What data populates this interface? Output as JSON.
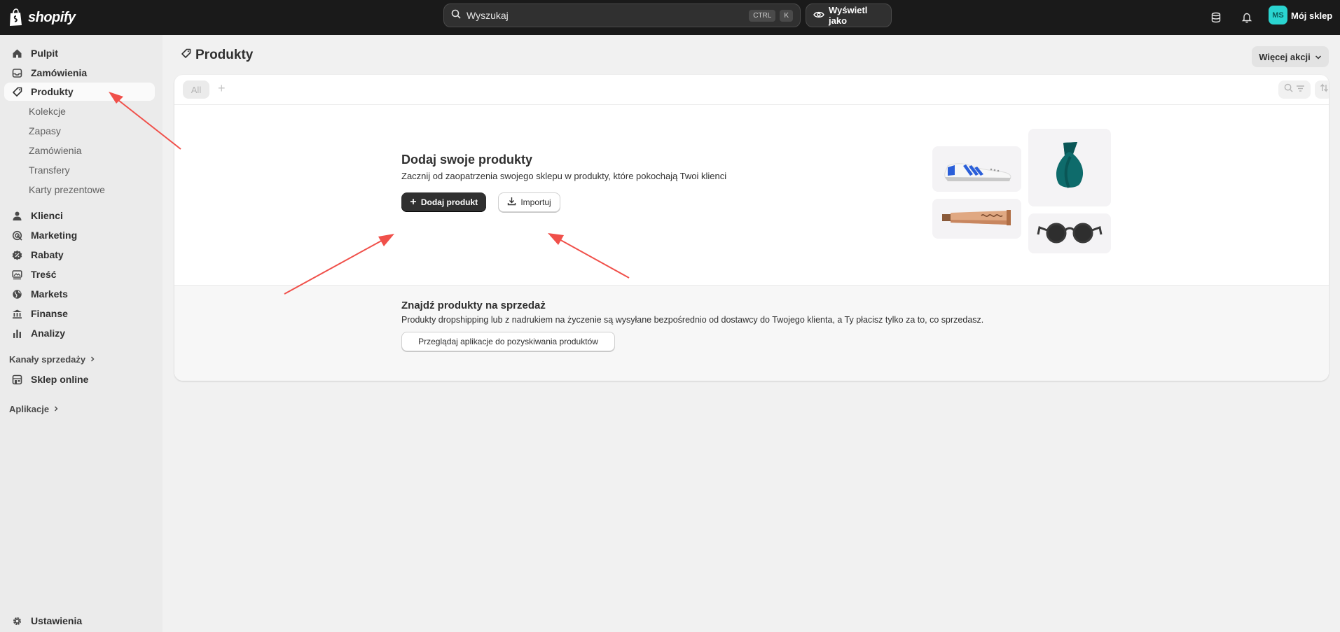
{
  "topbar": {
    "logo_text": "shopify",
    "search_placeholder": "Wyszukaj",
    "kbd_ctrl": "CTRL",
    "kbd_k": "K",
    "view_as_label": "Wyświetl jako",
    "avatar_initials": "MS",
    "store_name": "Mój sklep"
  },
  "sidebar": {
    "items": [
      {
        "label": "Pulpit"
      },
      {
        "label": "Zamówienia"
      },
      {
        "label": "Produkty"
      },
      {
        "label": "Klienci"
      },
      {
        "label": "Marketing"
      },
      {
        "label": "Rabaty"
      },
      {
        "label": "Treść"
      },
      {
        "label": "Markets"
      },
      {
        "label": "Finanse"
      },
      {
        "label": "Analizy"
      }
    ],
    "product_subitems": [
      "Kolekcje",
      "Zapasy",
      "Zamówienia",
      "Transfery",
      "Karty prezentowe"
    ],
    "sales_channels_label": "Kanały sprzedaży",
    "online_store_label": "Sklep online",
    "apps_label": "Aplikacje",
    "settings_label": "Ustawienia"
  },
  "page": {
    "title": "Produkty",
    "more_actions": "Więcej akcji",
    "tab_all": "All",
    "tab_add": "+"
  },
  "empty_state": {
    "title": "Dodaj swoje produkty",
    "subtitle": "Zacznij od zaopatrzenia swojego sklepu w produkty, które pokochają Twoi klienci",
    "primary_button": "Dodaj produkt",
    "secondary_button": "Importuj"
  },
  "find_products": {
    "title": "Znajdź produkty na sprzedaż",
    "subtitle": "Produkty dropshipping lub z nadrukiem na życzenie są wysyłane bezpośrednio od dostawcy do Twojego klienta, a Ty płacisz tylko za to, co sprzedasz.",
    "button": "Przeglądaj aplikacje do pozyskiwania produktów"
  },
  "colors": {
    "topbar_bg": "#1a1a1a",
    "avatar_bg": "#2ad4d0",
    "primary_button_bg": "#303030",
    "annotation_arrow": "#f0504a"
  }
}
